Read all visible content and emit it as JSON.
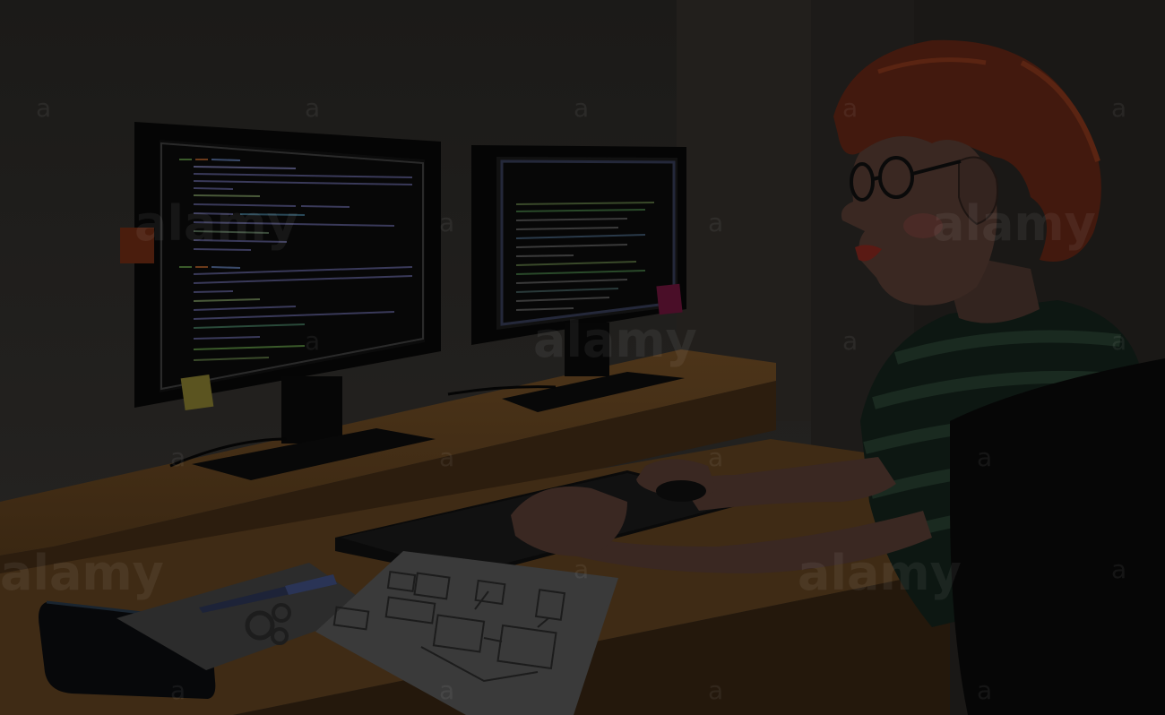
{
  "watermark": {
    "brand_text": "alamy",
    "mark_text": "a",
    "color": "#ffffff"
  },
  "palette": {
    "wall": "#1f1d1b",
    "wall_right": "#24211e",
    "desk_top": "#4a3318",
    "desk_edge": "#2c1d0e",
    "monitor_bezel": "#050505",
    "screen": "#0a0a0a",
    "hair": "#4a1f12",
    "skin": "#3b2a24",
    "shirt_dark": "#0f1a14",
    "shirt_stripe": "#1c2c22",
    "chair": "#070707",
    "paper": "#3d3d3d",
    "sticky_yellow": "#6b6420",
    "sticky_red": "#5c2010",
    "sticky_pink": "#5a1030"
  }
}
